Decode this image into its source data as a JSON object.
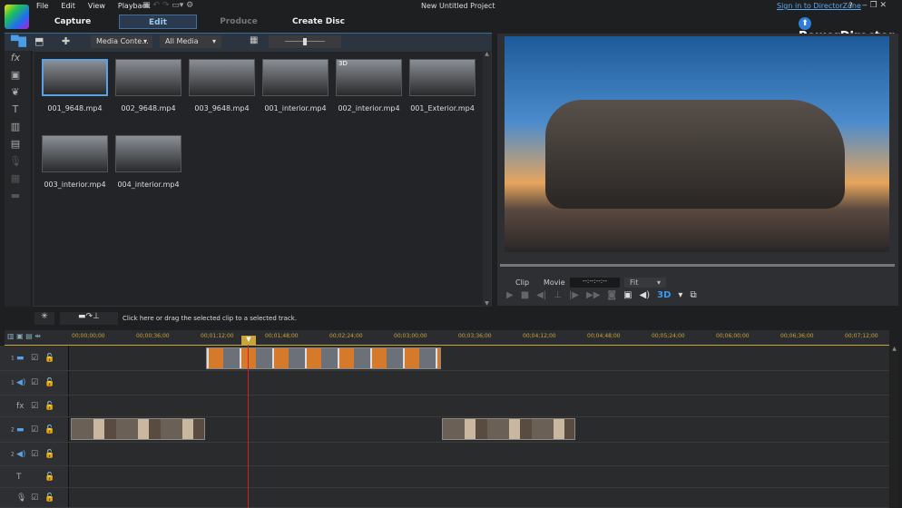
{
  "app": {
    "title": "New Untitled Project",
    "brand": "PowerDirector",
    "sign_in": "Sign in to DirectorZone",
    "help": "?"
  },
  "menu": [
    "File",
    "Edit",
    "View",
    "Playback"
  ],
  "tabs": [
    {
      "label": "Capture"
    },
    {
      "label": "Edit",
      "active": true
    },
    {
      "label": "Produce"
    },
    {
      "label": "Create Disc"
    }
  ],
  "library": {
    "content_dropdown": "Media Conte...",
    "filter_dropdown": "All Media",
    "items": [
      {
        "name": "001_9648.mp4",
        "selected": true
      },
      {
        "name": "002_9648.mp4"
      },
      {
        "name": "003_9648.mp4"
      },
      {
        "name": "001_interior.mp4"
      },
      {
        "name": "002_interior.mp4",
        "badge": "3D"
      },
      {
        "name": "001_Exterior.mp4"
      },
      {
        "name": "003_interior.mp4"
      },
      {
        "name": "004_interior.mp4"
      }
    ]
  },
  "preview": {
    "clip_label": "Clip",
    "movie_label": "Movie",
    "timecode": "--:--:--:--",
    "fit": "Fit",
    "three_d": "3D"
  },
  "action_bar": {
    "hint": "Click here or drag the selected clip to a selected track."
  },
  "timeline": {
    "ruler": [
      "00;00;00;00",
      "00;00;36;00",
      "00;01;12;00",
      "00;01;48;00",
      "00;02;24;00",
      "00;03;00;00",
      "00;03;36;00",
      "00;04;12;00",
      "00;04;48;00",
      "00;05;24;00",
      "00;06;00;00",
      "00;06;36;00",
      "00;07;12;00"
    ],
    "tracks": [
      {
        "num": "1",
        "type": "video"
      },
      {
        "num": "1",
        "type": "audio"
      },
      {
        "num": "",
        "type": "fx"
      },
      {
        "num": "2",
        "type": "video"
      },
      {
        "num": "2",
        "type": "audio"
      },
      {
        "num": "",
        "type": "title"
      },
      {
        "num": "",
        "type": "voice"
      }
    ]
  },
  "colors": {
    "accent": "#3f8fd8",
    "playhead": "#d02020",
    "ruler": "#c9a43a"
  }
}
